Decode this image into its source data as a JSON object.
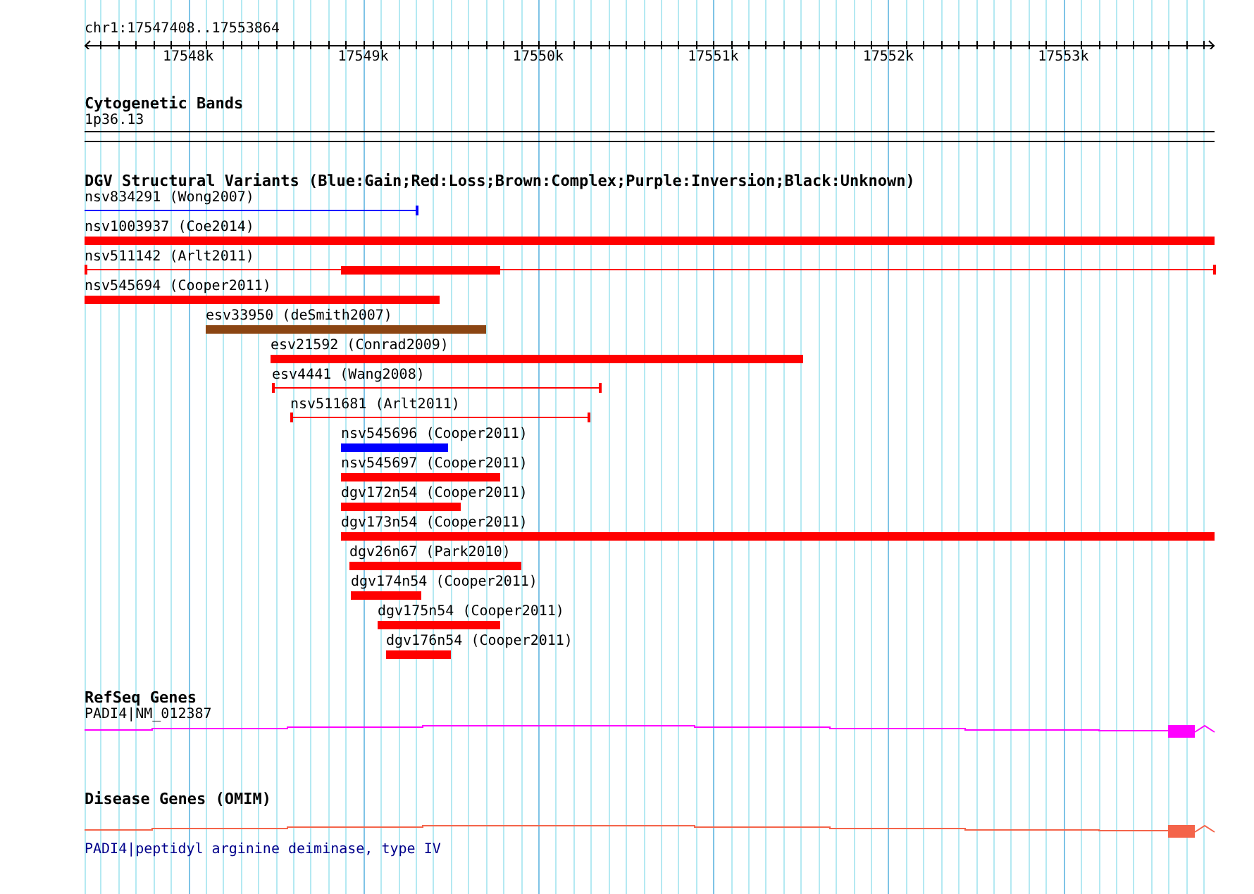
{
  "ruler": {
    "position": "chr1:17547408..17553864",
    "ticks": [
      "17548k",
      "17549k",
      "17550k",
      "17551k",
      "17552k",
      "17553k"
    ]
  },
  "tracks": [
    {
      "kind": "cytoband",
      "title": "Cytogenetic Bands",
      "label": "1p36.13"
    },
    {
      "kind": "variants",
      "title": "DGV Structural Variants (Blue:Gain;Red:Loss;Brown:Complex;Purple:Inversion;Black:Unknown)",
      "features": [
        {
          "label": "nsv834291 (Wong2007)",
          "kind": "line",
          "color": "#0000ff"
        },
        {
          "label": "nsv1003937 (Coe2014)",
          "kind": "bar",
          "color": "#ff0000"
        },
        {
          "label": "nsv511142 (Arlt2011)",
          "kind": "split",
          "color": "#ff0000"
        },
        {
          "label": "nsv545694 (Cooper2011)",
          "kind": "bar",
          "color": "#ff0000"
        },
        {
          "label": "esv33950 (deSmith2007)",
          "kind": "bar",
          "color": "#8b4513"
        },
        {
          "label": "esv21592 (Conrad2009)",
          "kind": "bar",
          "color": "#ff0000"
        },
        {
          "label": "esv4441 (Wang2008)",
          "kind": "bracket",
          "color": "#ff0000"
        },
        {
          "label": "nsv511681 (Arlt2011)",
          "kind": "bracket",
          "color": "#ff0000"
        },
        {
          "label": "nsv545696 (Cooper2011)",
          "kind": "bar",
          "color": "#0000ff"
        },
        {
          "label": "nsv545697 (Cooper2011)",
          "kind": "bar",
          "color": "#ff0000"
        },
        {
          "label": "dgv172n54 (Cooper2011)",
          "kind": "bar",
          "color": "#ff0000"
        },
        {
          "label": "dgv173n54 (Cooper2011)",
          "kind": "bar",
          "color": "#ff0000"
        },
        {
          "label": "dgv26n67 (Park2010)",
          "kind": "bar",
          "color": "#ff0000"
        },
        {
          "label": "dgv174n54 (Cooper2011)",
          "kind": "bar",
          "color": "#ff0000"
        },
        {
          "label": "dgv175n54 (Cooper2011)",
          "kind": "bar",
          "color": "#ff0000"
        },
        {
          "label": "dgv176n54 (Cooper2011)",
          "kind": "bar",
          "color": "#ff0000"
        }
      ]
    },
    {
      "kind": "gene",
      "title": "RefSeq Genes",
      "label": "PADI4|NM_012387",
      "color": "#ff00ff"
    },
    {
      "kind": "omim",
      "title": "Disease Genes (OMIM)",
      "label": "PADI4|peptidyl arginine deiminase, type IV",
      "color": "#f4644a"
    }
  ]
}
